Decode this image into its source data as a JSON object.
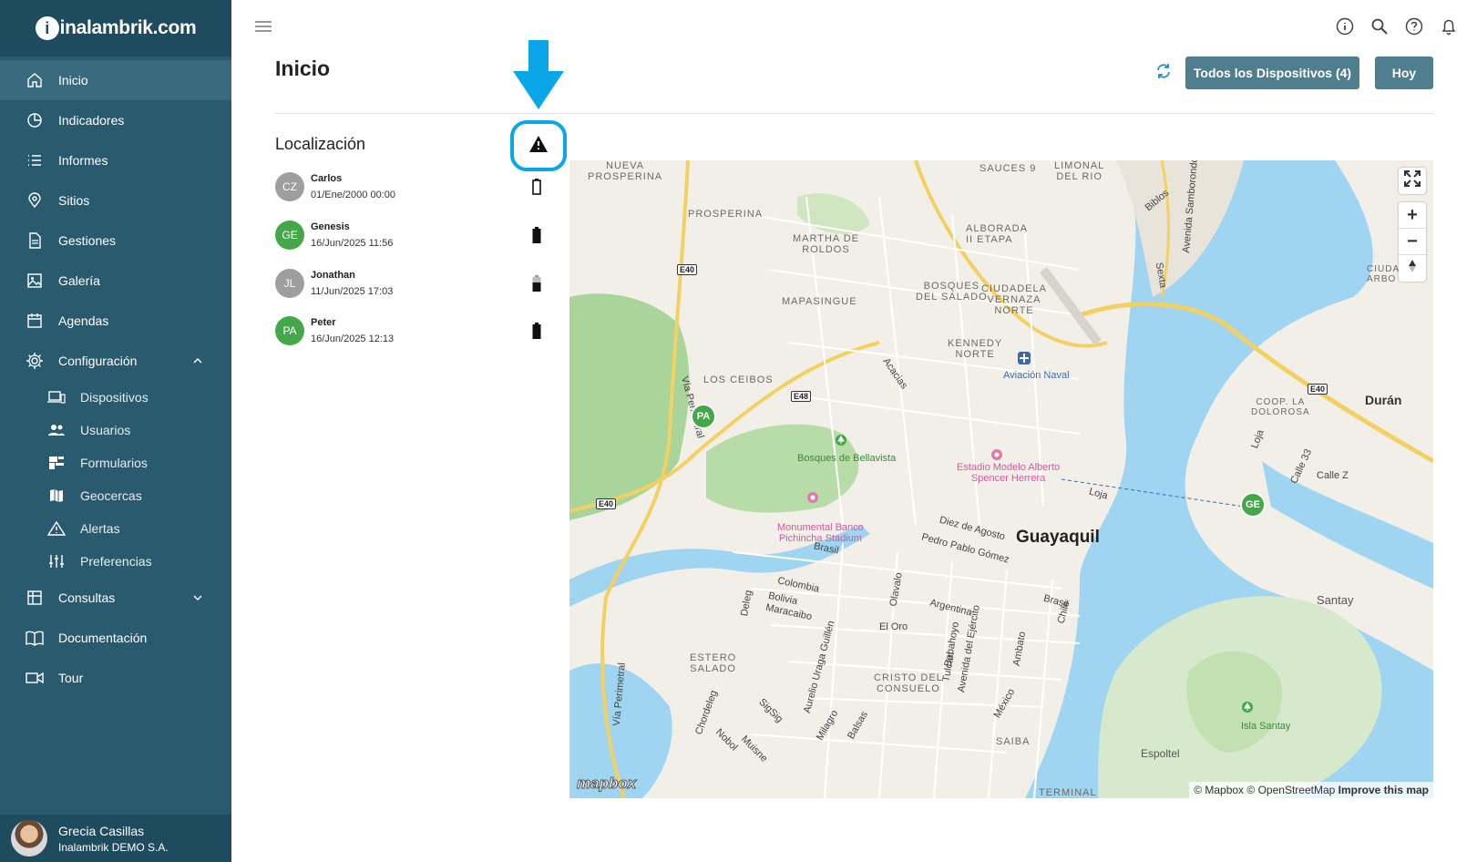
{
  "brand": {
    "name": "inalambrik.com"
  },
  "sidebar": {
    "items": [
      {
        "label": "Inicio",
        "icon": "home-icon",
        "active": true
      },
      {
        "label": "Indicadores",
        "icon": "pie-chart-icon"
      },
      {
        "label": "Informes",
        "icon": "list-icon"
      },
      {
        "label": "Sitios",
        "icon": "location-pin-icon"
      },
      {
        "label": "Gestiones",
        "icon": "document-icon"
      },
      {
        "label": "Galería",
        "icon": "image-icon"
      },
      {
        "label": "Agendas",
        "icon": "calendar-icon"
      },
      {
        "label": "Configuración",
        "icon": "gear-icon",
        "expanded": true
      },
      {
        "label": "Consultas",
        "icon": "table-icon",
        "expanded": false
      },
      {
        "label": "Documentación",
        "icon": "book-icon"
      },
      {
        "label": "Tour",
        "icon": "video-camera-icon"
      }
    ],
    "config_subitems": [
      {
        "label": "Dispositivos",
        "icon": "devices-icon"
      },
      {
        "label": "Usuarios",
        "icon": "users-icon"
      },
      {
        "label": "Formularios",
        "icon": "forms-icon"
      },
      {
        "label": "Geocercas",
        "icon": "map-icon"
      },
      {
        "label": "Alertas",
        "icon": "warning-icon"
      },
      {
        "label": "Preferencias",
        "icon": "sliders-icon"
      }
    ]
  },
  "user": {
    "name": "Grecia Casillas",
    "org": "Inalambrik DEMO S.A."
  },
  "header": {
    "title": "Inicio",
    "devices_button": "Todos los Dispositivos (4)",
    "today_button": "Hoy"
  },
  "location": {
    "title": "Localización",
    "devices": [
      {
        "initials": "CZ",
        "name": "Carlos",
        "date": "01/Ene/2000 00:00",
        "color": "#9e9e9e",
        "battery": "empty"
      },
      {
        "initials": "GE",
        "name": "Genesis",
        "date": "16/Jun/2025 11:56",
        "color": "#44a84a",
        "battery": "full"
      },
      {
        "initials": "JL",
        "name": "Jonathan",
        "date": "11/Jun/2025 17:03",
        "color": "#9e9e9e",
        "battery": "medium"
      },
      {
        "initials": "PA",
        "name": "Peter",
        "date": "16/Jun/2025 12:13",
        "color": "#44a84a",
        "battery": "full"
      }
    ]
  },
  "map": {
    "labels": {
      "nueva_prosperina": "NUEVA\nPROSPERINA",
      "prosperina": "PROSPERINA",
      "sauces": "SAUCES 9",
      "limonal": "LIMONAL\nDEL RIO",
      "alborada": "ALBORADA\nII ETAPA",
      "martha": "MARTHA DE\nROLDOS",
      "mapasingue": "MAPASINGUE",
      "bosques_salado": "BOSQUES\nDEL SALADO",
      "ciudadela": "CIUDADELA\nVERNAZA\nNORTE",
      "kennedy": "KENNEDY\nNORTE",
      "aviacion": "Aviación Naval",
      "los_ceibos": "LOS CEIBOS",
      "bellavista": "Bosques de Bellavista",
      "estadio": "Estadio Modelo Alberto\nSpencer Herrera",
      "monumental": "Monumental Banco\nPichincha Stadium",
      "guayaquil": "Guayaquil",
      "duran": "Durán",
      "coop_dolorosa": "COOP. LA\nDOLOROSA",
      "ciudad_arbolus": "CIUDA\nARBO",
      "santay": "Santay",
      "isla_santay": "Isla Santay",
      "estero_salado": "ESTERO\nSALADO",
      "cristo": "CRISTO DEL\nCONSUELO",
      "saiba": "SAIBA",
      "espoltel": "Espoltel",
      "terminal": "TERMINAL"
    },
    "streets": {
      "diez_agosto": "Diez de Agosto",
      "pedro_pablo": "Pedro Pablo Gómez",
      "brasil": "Brasil",
      "brasil2": "Brasil",
      "colombia": "Colombia",
      "bolivia": "Bolivia",
      "maracaibo": "Maracaibo",
      "argentina": "Argentina",
      "el_oro": "El Oro",
      "loja": "Loja",
      "loja2": "Loja",
      "calle_z": "Calle Z",
      "calle33": "Calle 33",
      "acacias": "Acacias",
      "via_perimetral": "Vía Perimetral",
      "via_perimetral2": "Vía Perimetral",
      "avenida_samborondon": "Avenida Samborondón",
      "biblos": "Biblos",
      "sexta": "Sexta",
      "olavalo": "Olavalo",
      "chile": "Chile",
      "babahoyo": "Babahoyo",
      "tulcan": "Tulcán",
      "ambato": "Ambato",
      "mexico": "México",
      "avenida_ejercito": "Avenida del Ejército",
      "aurelio": "Aurelio Uraga Guillén",
      "chordeleg": "Chordeleg",
      "nobol": "Nobol",
      "muisne": "Muisne",
      "sigsig": "SigSig",
      "milagro": "Milagro",
      "balsas": "Balsas",
      "deleg": "Deleg"
    },
    "shields": [
      "E40",
      "E48",
      "E40",
      "E40"
    ],
    "markers": [
      {
        "initials": "PA",
        "color": "#44a84a"
      },
      {
        "initials": "GE",
        "color": "#44a84a"
      }
    ],
    "controls": {
      "zoom_in": "+",
      "zoom_out": "−"
    },
    "attribution": {
      "mapbox": "© Mapbox",
      "osm": "© OpenStreetMap",
      "improve": "Improve this map"
    },
    "logo": "mapbox"
  },
  "colors": {
    "sidebar_bg": "#2a5a6e",
    "sidebar_dark": "#1f4b5e",
    "button_bg": "#4f7f8f",
    "highlight": "#0aa6e8",
    "water": "#9fd5f0",
    "park": "#cfe6c0"
  }
}
